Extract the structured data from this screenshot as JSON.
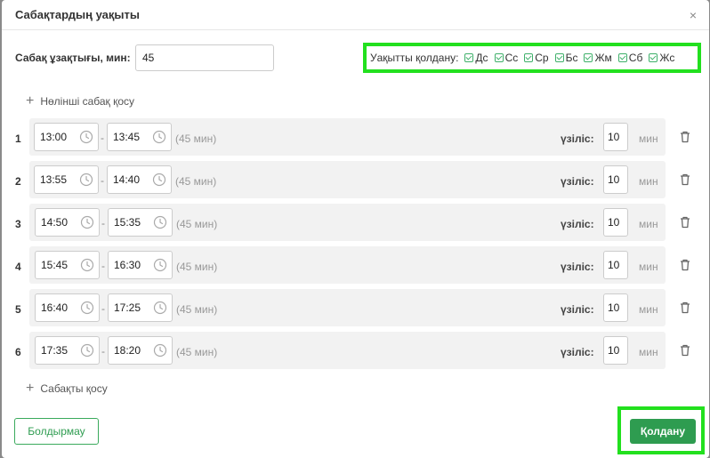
{
  "dialog": {
    "title": "Сабақтардың уақыты",
    "close_symbol": "×"
  },
  "duration": {
    "label": "Сабақ ұзақтығы, мин:",
    "value": "45"
  },
  "apply_days": {
    "label": "Уақытты қолдану:",
    "days": [
      {
        "label": "Дс",
        "checked": true
      },
      {
        "label": "Сс",
        "checked": true
      },
      {
        "label": "Ср",
        "checked": true
      },
      {
        "label": "Бс",
        "checked": true
      },
      {
        "label": "Жм",
        "checked": true
      },
      {
        "label": "Сб",
        "checked": true
      },
      {
        "label": "Жс",
        "checked": true
      }
    ]
  },
  "add_zero_lesson": "Нөлінші сабақ қосу",
  "add_lesson": "Сабақты қосу",
  "break_label": "үзіліс:",
  "break_unit": "мин",
  "lessons": [
    {
      "num": "1",
      "start": "13:00",
      "end": "13:45",
      "duration": "(45 мин)",
      "break": "10"
    },
    {
      "num": "2",
      "start": "13:55",
      "end": "14:40",
      "duration": "(45 мин)",
      "break": "10"
    },
    {
      "num": "3",
      "start": "14:50",
      "end": "15:35",
      "duration": "(45 мин)",
      "break": "10"
    },
    {
      "num": "4",
      "start": "15:45",
      "end": "16:30",
      "duration": "(45 мин)",
      "break": "10"
    },
    {
      "num": "5",
      "start": "16:40",
      "end": "17:25",
      "duration": "(45 мин)",
      "break": "10"
    },
    {
      "num": "6",
      "start": "17:35",
      "end": "18:20",
      "duration": "(45 мин)",
      "break": "10"
    }
  ],
  "footer": {
    "cancel_label": "Болдырмау",
    "apply_label": "Қолдану"
  },
  "colors": {
    "accent": "#2e9c50",
    "highlight": "#22e01e",
    "row_bg": "#f2f2f2"
  }
}
